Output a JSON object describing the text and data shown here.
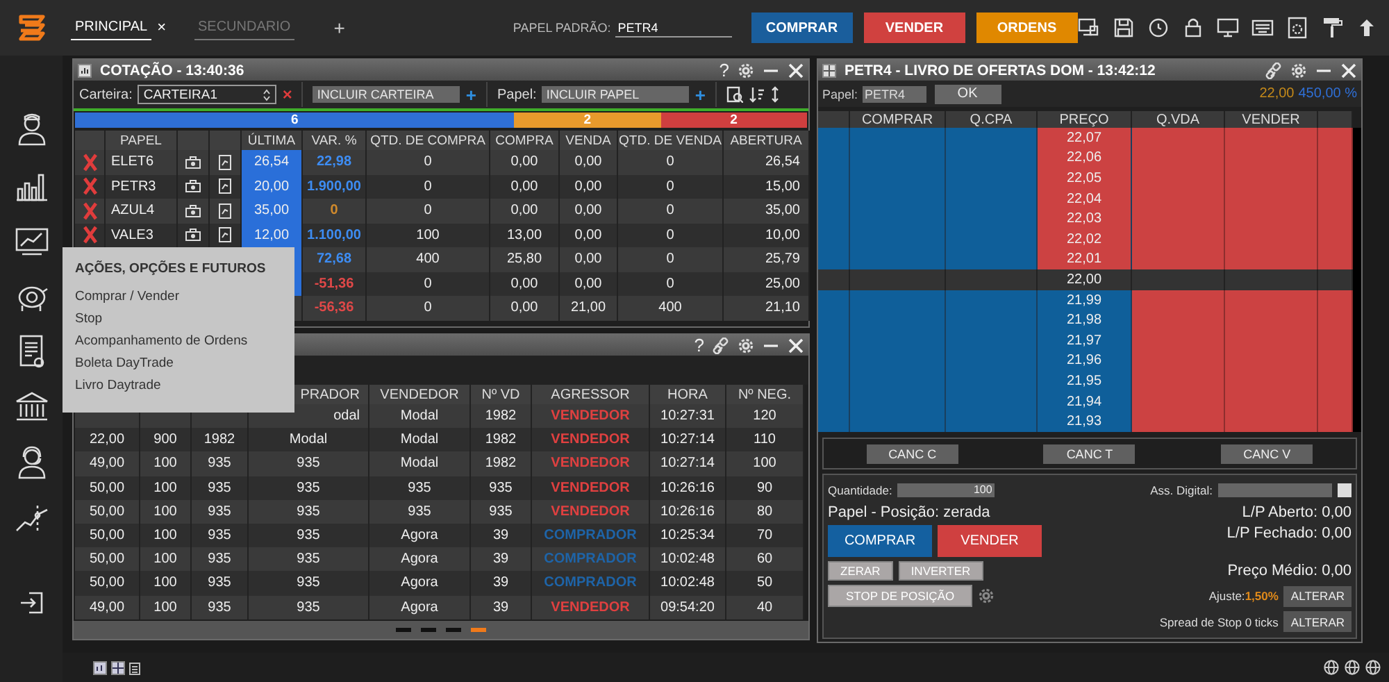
{
  "top_bar": {
    "tabs": [
      {
        "label": "PRINCIPAL",
        "selected": true,
        "close": "×"
      },
      {
        "label": "SECUNDARIO",
        "selected": false
      }
    ],
    "add_tab": "+",
    "default_symbol": {
      "label": "PAPEL PADRÃO:",
      "value": "PETR4"
    },
    "buttons": [
      {
        "label": "COMPRAR",
        "kind": "buy"
      },
      {
        "label": "VENDER",
        "kind": "sell"
      },
      {
        "label": "ORDENS",
        "kind": "orders"
      }
    ]
  },
  "quote_panel": {
    "title": "COTAÇÃO - 13:40:36",
    "help": "?",
    "portfolio_label": "Carteira:",
    "portfolio": "CARTEIRA1",
    "remove_portfolio": "×",
    "portfolio_placeholder": "INCLUIR CARTEIRA",
    "add_portfolio": "+",
    "symbol_label": "Papel:",
    "symbol_placeholder": "INCLUIR PAPEL",
    "add_symbol": "+",
    "counts": [
      {
        "value": "6",
        "color": "#2f6fd6"
      },
      {
        "value": "2",
        "color": "#e89a2c"
      },
      {
        "value": "2",
        "color": "#cf3f3f"
      }
    ],
    "columns": [
      "",
      "PAPEL",
      "",
      "",
      "ÚLTIMA",
      "VAR. %",
      "QTD. DE COMPRA",
      "COMPRA",
      "VENDA",
      "QTD. DE VENDA",
      "ABERTURA"
    ],
    "rows": [
      {
        "symbol": "ELET6",
        "last": "26,54",
        "highlight": true,
        "change": "22,98",
        "color": "#3d8cf2",
        "bid_qty": "0",
        "bid": "0,00",
        "ask": "0,00",
        "ask_qty": "0",
        "open": "26,54"
      },
      {
        "symbol": "PETR3",
        "last": "20,00",
        "highlight": true,
        "change": "1.900,00",
        "color": "#3d8cf2",
        "bid_qty": "0",
        "bid": "0,00",
        "ask": "0,00",
        "ask_qty": "0",
        "open": "15,00"
      },
      {
        "symbol": "AZUL4",
        "last": "35,00",
        "highlight": true,
        "change": "0",
        "color": "#d08a2c",
        "bid_qty": "0",
        "bid": "0,00",
        "ask": "0,00",
        "ask_qty": "0",
        "open": "35,00"
      },
      {
        "symbol": "VALE3",
        "last": "12,00",
        "highlight": true,
        "change": "1.100,00",
        "color": "#3d8cf2",
        "bid_qty": "100",
        "bid": "13,00",
        "ask": "0,00",
        "ask_qty": "0",
        "open": "10,00"
      },
      {
        "symbol": "",
        "last": "",
        "highlight": true,
        "change": "72,68",
        "color": "#3d8cf2",
        "bid_qty": "400",
        "bid": "25,80",
        "ask": "0,00",
        "ask_qty": "0",
        "open": "25,79"
      },
      {
        "symbol": "",
        "last": "",
        "highlight": true,
        "change": "-51,36",
        "color": "#e04848",
        "bid_qty": "0",
        "bid": "0,00",
        "ask": "0,00",
        "ask_qty": "0",
        "open": "25,00"
      },
      {
        "symbol": "",
        "last": "",
        "highlight": false,
        "change": "-56,36",
        "color": "#e04848",
        "bid_qty": "0",
        "bid": "0,00",
        "ask": "21,00",
        "ask_qty": "400",
        "open": "21,10"
      }
    ]
  },
  "trades_panel": {
    "help": "?",
    "columns": [
      {},
      {},
      {},
      {
        "label": "PRADOR",
        "clipped": true
      },
      {
        "label": "VENDEDOR"
      },
      {
        "label": "Nº VD"
      },
      {
        "label": "AGRESSOR"
      },
      {
        "label": "HORA"
      },
      {
        "label": "Nº NEG."
      }
    ],
    "rows": [
      {
        "cells": [
          "",
          "",
          "",
          {
            "text": "odal",
            "clipped": true
          },
          "Modal",
          "1982"
        ],
        "aggressor": "VENDEDOR",
        "color": "#e04040",
        "time": "10:27:31",
        "trade_no": "120"
      },
      {
        "cells": [
          "22,00",
          "900",
          "1982",
          "Modal",
          "Modal",
          "1982"
        ],
        "aggressor": "VENDEDOR",
        "color": "#e04040",
        "time": "10:27:14",
        "trade_no": "110"
      },
      {
        "cells": [
          "49,00",
          "100",
          "935",
          "935",
          "Modal",
          "1982"
        ],
        "aggressor": "VENDEDOR",
        "color": "#e04040",
        "time": "10:27:14",
        "trade_no": "100"
      },
      {
        "cells": [
          "50,00",
          "100",
          "935",
          "935",
          "935",
          "935"
        ],
        "aggressor": "VENDEDOR",
        "color": "#e04040",
        "time": "10:26:16",
        "trade_no": "90"
      },
      {
        "cells": [
          "50,00",
          "100",
          "935",
          "935",
          "935",
          "935"
        ],
        "aggressor": "VENDEDOR",
        "color": "#e04040",
        "time": "10:26:16",
        "trade_no": "80"
      },
      {
        "cells": [
          "50,00",
          "100",
          "935",
          "935",
          "Agora",
          "39"
        ],
        "aggressor": "COMPRADOR",
        "color": "#1e64a8",
        "time": "10:25:34",
        "trade_no": "70"
      },
      {
        "cells": [
          "50,00",
          "100",
          "935",
          "935",
          "Agora",
          "39"
        ],
        "aggressor": "COMPRADOR",
        "color": "#1e64a8",
        "time": "10:02:48",
        "trade_no": "60"
      },
      {
        "cells": [
          "50,00",
          "100",
          "935",
          "935",
          "Agora",
          "39"
        ],
        "aggressor": "COMPRADOR",
        "color": "#1e64a8",
        "time": "10:02:48",
        "trade_no": "50"
      },
      {
        "cells": [
          "49,00",
          "100",
          "935",
          "935",
          "Agora",
          "39"
        ],
        "aggressor": "VENDEDOR",
        "color": "#e04040",
        "time": "09:54:20",
        "trade_no": "40"
      }
    ],
    "pages": [
      {
        "selected": false
      },
      {
        "selected": false
      },
      {
        "selected": false
      },
      {
        "selected": true
      }
    ]
  },
  "book_panel": {
    "title": "PETR4 - LIVRO DE OFERTAS DOM - 13:42:12",
    "symbol_label": "Papel:",
    "symbol": "PETR4",
    "ok": "OK",
    "last_price": "22,00",
    "change": "450,00 %",
    "columns": [
      "",
      "COMPRAR",
      "Q.CPA",
      "PREÇO",
      "Q.VDA",
      "VENDER",
      ""
    ],
    "levels": [
      {
        "price": "22,07",
        "kind": "ask"
      },
      {
        "price": "22,06",
        "kind": "ask"
      },
      {
        "price": "22,05",
        "kind": "ask"
      },
      {
        "price": "22,04",
        "kind": "ask"
      },
      {
        "price": "22,03",
        "kind": "ask"
      },
      {
        "price": "22,02",
        "kind": "ask"
      },
      {
        "price": "22,01",
        "kind": "ask"
      },
      {
        "price": "22,00",
        "kind": "last"
      },
      {
        "price": "21,99",
        "kind": "bid"
      },
      {
        "price": "21,98",
        "kind": "bid"
      },
      {
        "price": "21,97",
        "kind": "bid"
      },
      {
        "price": "21,96",
        "kind": "bid"
      },
      {
        "price": "21,95",
        "kind": "bid"
      },
      {
        "price": "21,94",
        "kind": "bid"
      },
      {
        "price": "21,93",
        "kind": "bid"
      }
    ],
    "cancel_buttons": [
      "CANC C",
      "CANC T",
      "CANC V"
    ],
    "order": {
      "quantity_label": "Quantidade:",
      "quantity": "100",
      "signature_label": "Ass. Digital:",
      "signature_checked": false,
      "position": "Papel - Posição: zerada",
      "open_pl": "L/P Aberto: 0,00",
      "closed_pl": "L/P Fechado: 0,00",
      "average_price": "Preço Médio: 0,00",
      "buttons": [
        {
          "label": "COMPRAR",
          "kind": "buy"
        },
        {
          "label": "VENDER",
          "kind": "sell"
        }
      ],
      "actions": [
        "ZERAR",
        "INVERTER"
      ],
      "stop": "STOP DE POSIÇÃO",
      "adjust_label": "Ajuste:",
      "adjust_value": "1,50%",
      "adjust_button": "ALTERAR",
      "spread": "Spread de Stop 0 ticks",
      "spread_button": "ALTERAR"
    }
  },
  "menu": {
    "title": "AÇÕES, OPÇÕES E FUTUROS",
    "items": [
      "Comprar / Vender",
      "Stop",
      "Acompanhamento de Ordens",
      "Boleta DayTrade",
      "Livro Daytrade"
    ]
  }
}
